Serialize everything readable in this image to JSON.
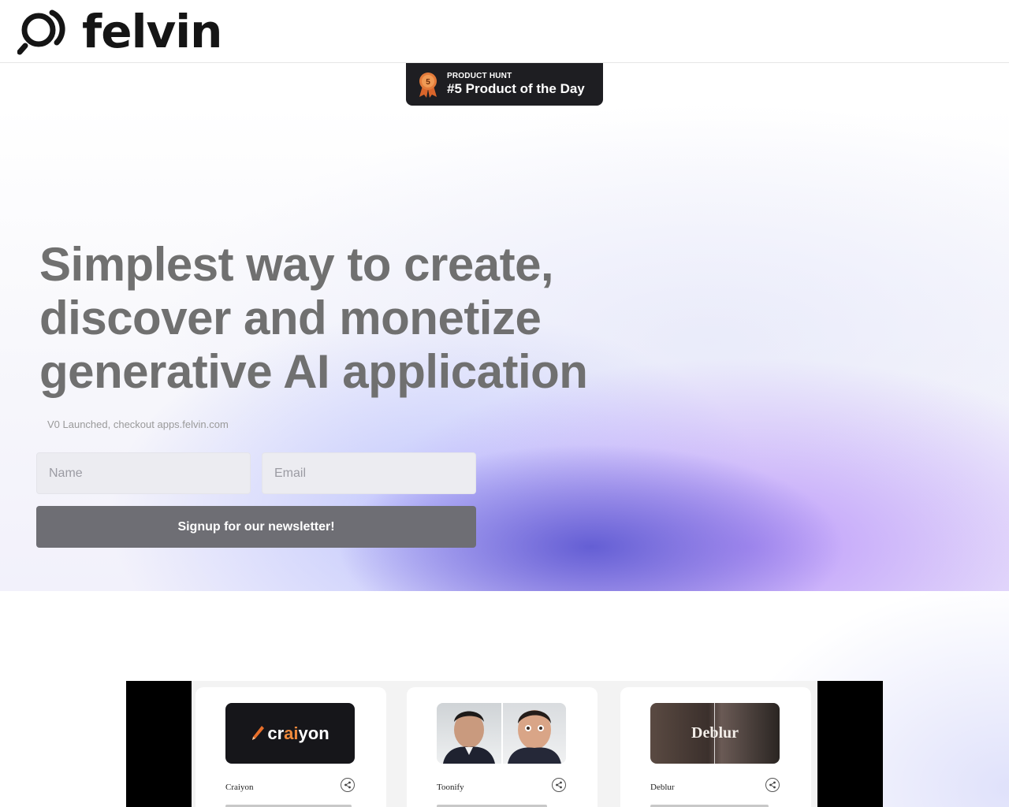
{
  "header": {
    "logo_text": "felvin"
  },
  "badge": {
    "medal_number": "5",
    "label_small": "PRODUCT HUNT",
    "label_large": "#5 Product of the Day"
  },
  "hero": {
    "title": "Simplest way to create, discover and monetize generative AI application",
    "subtitle": "V0 Launched, checkout apps.felvin.com",
    "name_placeholder": "Name",
    "email_placeholder": "Email",
    "signup_label": "Signup for our newsletter!"
  },
  "apps": [
    {
      "name": "Craiyon",
      "thumb_text_a": "cr",
      "thumb_text_b": "ai",
      "thumb_text_c": "yon"
    },
    {
      "name": "Toonify"
    },
    {
      "name": "Deblur",
      "thumb_text": "Deblur"
    }
  ],
  "colors": {
    "title": "#707070",
    "button": "#6e6e74",
    "badge_bg": "#1e1e22",
    "accent_purple": "#b48cfa",
    "craiyon_accent": "#f08a3c"
  },
  "icons": {
    "logo": "felvin-logo-icon",
    "medal": "medal-icon",
    "share": "share-icon",
    "pencil": "pencil-icon"
  }
}
